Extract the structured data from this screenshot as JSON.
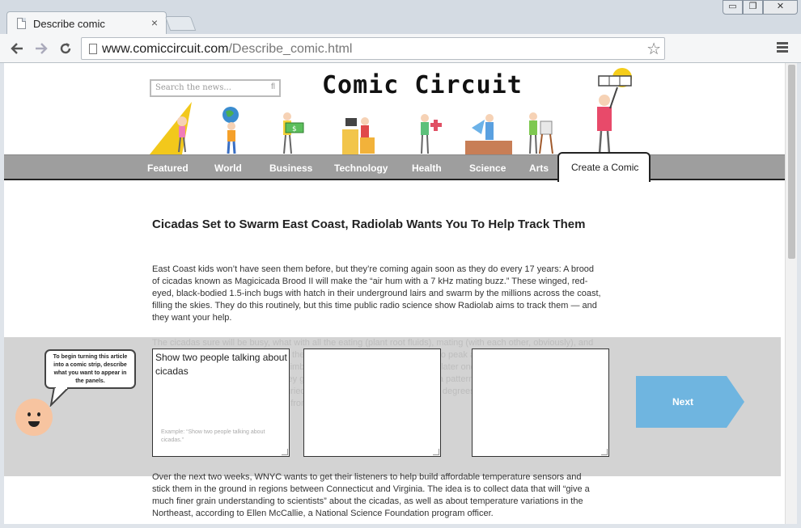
{
  "browser": {
    "tab_title": "Describe comic",
    "tab_close": "×",
    "url_host": "www.comiccircuit.com",
    "url_path": "/Describe_comic.html",
    "back_icon": "arrow-left",
    "forward_icon": "arrow-right",
    "reload_icon": "reload",
    "star_icon": "star",
    "window_min": "▭",
    "window_max": "❐",
    "window_close": "✕"
  },
  "site": {
    "logo": "Comic Circuit",
    "search_placeholder": "Search the news...",
    "nav": [
      "Featured",
      "World",
      "Business",
      "Technology",
      "Health",
      "Science",
      "Arts"
    ],
    "nav_active": "Create a Comic"
  },
  "article": {
    "title": "Cicadas Set to Swarm East Coast, Radiolab Wants You To Help Track Them",
    "p1": "East Coast kids won’t have seen them before, but they’re coming again soon as they do every 17 years: A brood of cicadas known as Magicicada Brood II will make the “air hum with a 7 kHz mating buzz.” These winged, red-eyed, black-bodied 1.5-inch bugs with hatch in their underground lairs and swarm by the millions across the coast, filling the skies. They do this routinely, but this time public radio science show Radiolab aims to track them — and they want your help.",
    "p_faded": "The cicadas sure will be busy, what with all the eating (plant root fluids), mating (with each other, obviously), and dying they’ll do, and not to mention the noise. Mostly it’s just a spectacle to peak at, though, as they emerge from the ground, shed their skins, and climb the trees, only to die a few weeks later once they’ve mated and laid their eggs. But where, and when, are they going to emerge, exactly? There is a pattern, just the trick is knowing the soil temperature in the areas they’re buried. Once the ground warms up to 64 degrees, they’ll start to come out, ready to take over the East Coast states, from Georgia to New York.",
    "p2": "Over the next two weeks, WNYC wants to get their listeners to help build affordable temperature sensors and stick them in the ground in regions between Connecticut and Virginia. The idea is to collect data that will “give a much finer grain understanding to scientists” about the cicadas, as well as about temperature variations in the Northeast, according to Ellen McCallie, a National Science Foundation program officer."
  },
  "comic_builder": {
    "helper_text": "To begin turning this article into a comic strip, describe what you want to appear in the panels.",
    "panel1_value": "Show two people talking about cicadas",
    "panel1_example": "Example: “Show two people talking about cicadas.”",
    "panel2_value": "",
    "panel3_value": "",
    "next_label": "Next",
    "next_color": "#6fb5e0"
  }
}
